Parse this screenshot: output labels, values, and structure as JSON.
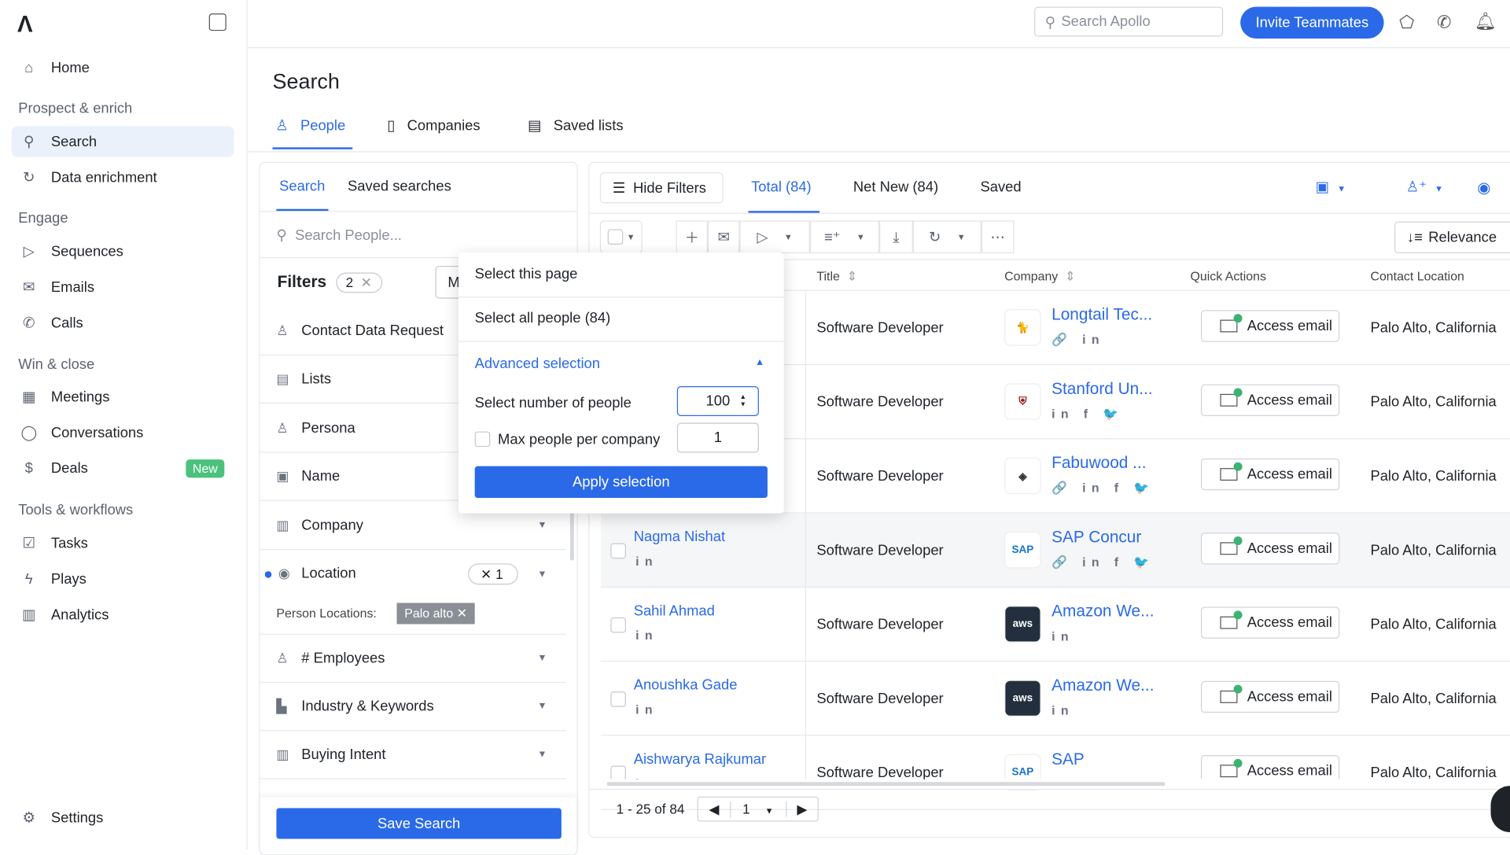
{
  "sidebar": {
    "home": "Home",
    "sec1": "Prospect & enrich",
    "search": "Search",
    "enrich": "Data enrichment",
    "sec2": "Engage",
    "sequences": "Sequences",
    "emails": "Emails",
    "calls": "Calls",
    "sec3": "Win & close",
    "meetings": "Meetings",
    "conversations": "Conversations",
    "deals": "Deals",
    "deals_badge": "New",
    "sec4": "Tools & workflows",
    "tasks": "Tasks",
    "plays": "Plays",
    "analytics": "Analytics",
    "settings": "Settings"
  },
  "topbar": {
    "search_placeholder": "Search Apollo",
    "invite": "Invite Teammates"
  },
  "page": {
    "title": "Search",
    "tabs": [
      "People",
      "Companies",
      "Saved lists"
    ]
  },
  "filters": {
    "tabs": [
      "Search",
      "Saved searches"
    ],
    "search_placeholder": "Search People...",
    "title": "Filters",
    "count": "2",
    "more_btn": "M",
    "items": [
      "Contact Data Request",
      "Lists",
      "Persona",
      "Name",
      "Company",
      "Location",
      "# Employees",
      "Industry & Keywords",
      "Buying Intent"
    ],
    "location_count": "1",
    "person_locations_label": "Person Locations:",
    "location_chip": "Palo alto",
    "save": "Save Search"
  },
  "results": {
    "hide_filters": "Hide Filters",
    "tabs": [
      "Total (84)",
      "Net New (84)",
      "Saved"
    ],
    "sort": "Relevance",
    "columns": [
      "Title",
      "Company",
      "Quick Actions",
      "Contact Location"
    ],
    "rows": [
      {
        "name": "",
        "title": "Software Developer",
        "company": "Longtail Tec...",
        "action": "Access email",
        "location": "Palo Alto, California",
        "social": "🔗 in",
        "logo": "longtail"
      },
      {
        "name": "",
        "title": "Software Developer",
        "company": "Stanford Un...",
        "action": "Access email",
        "location": "Palo Alto, California",
        "social": "in f 🐦",
        "logo": "stanford"
      },
      {
        "name": "",
        "title": "Software Developer",
        "company": "Fabuwood ...",
        "action": "Access email",
        "location": "Palo Alto, California",
        "social": "🔗 in f 🐦",
        "logo": "fabuwood"
      },
      {
        "name": "Nagma Nishat",
        "title": "Software Developer",
        "company": "SAP Concur",
        "action": "Access email",
        "location": "Palo Alto, California",
        "social": "🔗 in f 🐦",
        "logo": "sap"
      },
      {
        "name": "Sahil Ahmad",
        "title": "Software Developer",
        "company": "Amazon We...",
        "action": "Access email",
        "location": "Palo Alto, California",
        "social": "in",
        "logo": "aws"
      },
      {
        "name": "Anoushka Gade",
        "title": "Software Developer",
        "company": "Amazon We...",
        "action": "Access email",
        "location": "Palo Alto, California",
        "social": "in",
        "logo": "aws"
      },
      {
        "name": "Aishwarya Rajkumar",
        "title": "Software Developer",
        "company": "SAP",
        "action": "Access email",
        "location": "Palo Alto, California",
        "social": "",
        "logo": "sap"
      }
    ],
    "pagination": {
      "range": "1 - 25 of 84",
      "page": "1"
    }
  },
  "dropdown": {
    "select_page": "Select this page",
    "select_all": "Select all people (84)",
    "advanced": "Advanced selection",
    "num_label": "Select number of people",
    "num_value": "100",
    "max_label": "Max people per company",
    "max_value": "1",
    "apply": "Apply selection"
  },
  "colors": {
    "accent": "#2a6ae8",
    "new_badge": "#4ac27d"
  }
}
